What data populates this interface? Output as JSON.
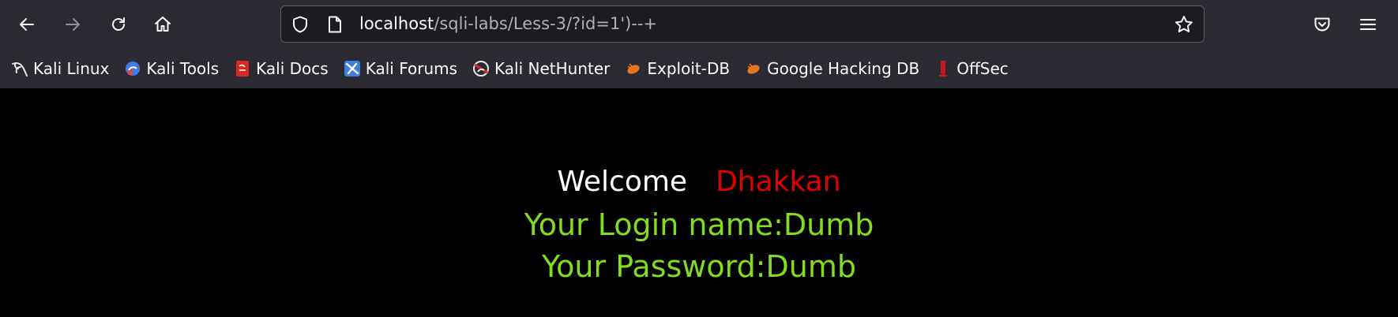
{
  "browser": {
    "url_host": "localhost",
    "url_path": "/sqli-labs/Less-3/?id=1')--+"
  },
  "bookmarks": [
    {
      "label": "Kali Linux",
      "icon": "kali-dragon-icon"
    },
    {
      "label": "Kali Tools",
      "icon": "kali-tools-icon"
    },
    {
      "label": "Kali Docs",
      "icon": "kali-docs-icon"
    },
    {
      "label": "Kali Forums",
      "icon": "kali-forums-icon"
    },
    {
      "label": "Kali NetHunter",
      "icon": "kali-nethunter-icon"
    },
    {
      "label": "Exploit-DB",
      "icon": "exploit-db-icon"
    },
    {
      "label": "Google Hacking DB",
      "icon": "ghdb-icon"
    },
    {
      "label": "OffSec",
      "icon": "offsec-icon"
    }
  ],
  "page": {
    "welcome_text": "Welcome",
    "welcome_name": "Dhakkan",
    "login_line": "Your Login name:Dumb",
    "password_line": "Your Password:Dumb"
  },
  "colors": {
    "chrome_bg": "#2b2a33",
    "page_bg": "#000000",
    "welcome_name": "#e10000",
    "result_text": "#82dc1f"
  }
}
